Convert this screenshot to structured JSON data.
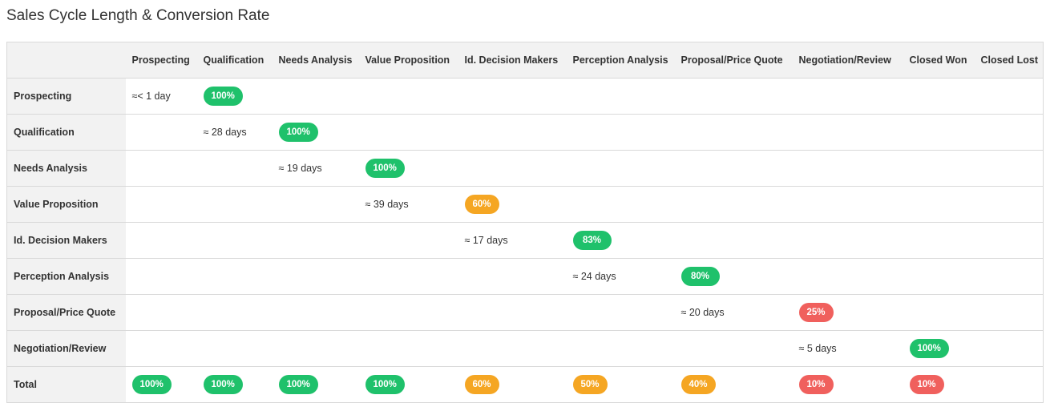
{
  "title": "Sales Cycle Length & Conversion Rate",
  "colors": {
    "green": "#1fc16b",
    "orange": "#f5a623",
    "red": "#f0605d",
    "header_bg": "#f2f2f2",
    "border": "#d9d9d9"
  },
  "columns": [
    "Prospecting",
    "Qualification",
    "Needs Analysis",
    "Value Proposition",
    "Id. Decision Makers",
    "Perception Analysis",
    "Proposal/Price Quote",
    "Negotiation/Review",
    "Closed Won",
    "Closed Lost"
  ],
  "rows": [
    {
      "label": "Prospecting",
      "cells": [
        {
          "type": "days",
          "text": "≈< 1 day"
        },
        {
          "type": "badge",
          "text": "100%",
          "color": "green"
        },
        null,
        null,
        null,
        null,
        null,
        null,
        null,
        null
      ]
    },
    {
      "label": "Qualification",
      "cells": [
        null,
        {
          "type": "days",
          "text": "≈ 28 days"
        },
        {
          "type": "badge",
          "text": "100%",
          "color": "green"
        },
        null,
        null,
        null,
        null,
        null,
        null,
        null
      ]
    },
    {
      "label": "Needs Analysis",
      "cells": [
        null,
        null,
        {
          "type": "days",
          "text": "≈ 19 days"
        },
        {
          "type": "badge",
          "text": "100%",
          "color": "green"
        },
        null,
        null,
        null,
        null,
        null,
        null
      ]
    },
    {
      "label": "Value Proposition",
      "cells": [
        null,
        null,
        null,
        {
          "type": "days",
          "text": "≈ 39 days"
        },
        {
          "type": "badge",
          "text": "60%",
          "color": "orange"
        },
        null,
        null,
        null,
        null,
        null
      ]
    },
    {
      "label": "Id. Decision Makers",
      "cells": [
        null,
        null,
        null,
        null,
        {
          "type": "days",
          "text": "≈ 17 days"
        },
        {
          "type": "badge",
          "text": "83%",
          "color": "green"
        },
        null,
        null,
        null,
        null
      ]
    },
    {
      "label": "Perception Analysis",
      "cells": [
        null,
        null,
        null,
        null,
        null,
        {
          "type": "days",
          "text": "≈ 24 days"
        },
        {
          "type": "badge",
          "text": "80%",
          "color": "green"
        },
        null,
        null,
        null
      ]
    },
    {
      "label": "Proposal/Price Quote",
      "cells": [
        null,
        null,
        null,
        null,
        null,
        null,
        {
          "type": "days",
          "text": "≈ 20 days"
        },
        {
          "type": "badge",
          "text": "25%",
          "color": "red"
        },
        null,
        null
      ]
    },
    {
      "label": "Negotiation/Review",
      "cells": [
        null,
        null,
        null,
        null,
        null,
        null,
        null,
        {
          "type": "days",
          "text": "≈ 5 days"
        },
        {
          "type": "badge",
          "text": "100%",
          "color": "green"
        },
        null
      ]
    },
    {
      "label": "Total",
      "cells": [
        {
          "type": "badge",
          "text": "100%",
          "color": "green"
        },
        {
          "type": "badge",
          "text": "100%",
          "color": "green"
        },
        {
          "type": "badge",
          "text": "100%",
          "color": "green"
        },
        {
          "type": "badge",
          "text": "100%",
          "color": "green"
        },
        {
          "type": "badge",
          "text": "60%",
          "color": "orange"
        },
        {
          "type": "badge",
          "text": "50%",
          "color": "orange"
        },
        {
          "type": "badge",
          "text": "40%",
          "color": "orange"
        },
        {
          "type": "badge",
          "text": "10%",
          "color": "red"
        },
        {
          "type": "badge",
          "text": "10%",
          "color": "red"
        },
        null
      ]
    }
  ]
}
